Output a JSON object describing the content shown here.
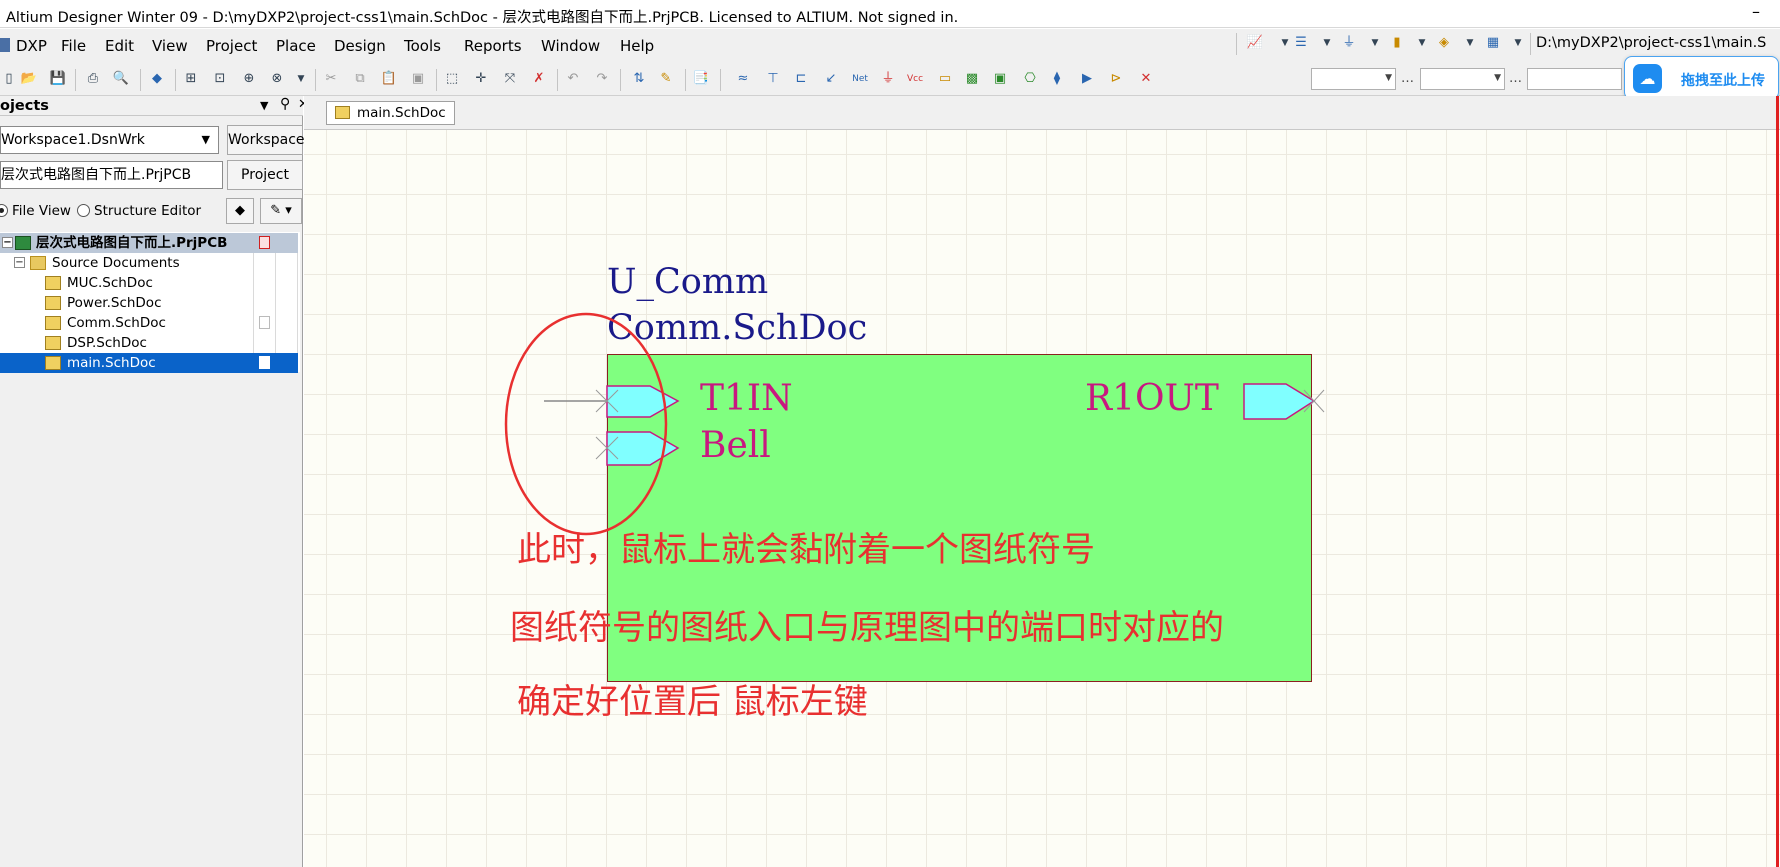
{
  "window": {
    "title": "Altium Designer Winter 09 - D:\\myDXP2\\project-css1\\main.SchDoc - 层次式电路图自下而上.PrjPCB. Licensed to ALTIUM. Not signed in.",
    "minimize_symbol": "–"
  },
  "menu": {
    "items": [
      "DXP",
      "File",
      "Edit",
      "View",
      "Project",
      "Place",
      "Design",
      "Tools",
      "Reports",
      "Window",
      "Help"
    ]
  },
  "path_box": "D:\\myDXP2\\project-css1\\main.S",
  "upload_button": {
    "label": "拖拽至此上传",
    "logo": "baidu-netdisk-icon"
  },
  "projects_panel": {
    "title": "ojects",
    "workspace_field": "Workspace1.DsnWrk",
    "workspace_button": "Workspace",
    "project_field": "层次式电路图自下而上.PrjPCB",
    "project_button": "Project",
    "file_view_label": "File View",
    "structure_editor_label": "Structure Editor",
    "file_view_selected": true,
    "tree": {
      "project": "层次式电路图自下而上.PrjPCB",
      "folder": "Source Documents",
      "documents": [
        "MUC.SchDoc",
        "Power.SchDoc",
        "Comm.SchDoc",
        "DSP.SchDoc",
        "main.SchDoc"
      ],
      "selected_document": "main.SchDoc"
    }
  },
  "document_tab": "main.SchDoc",
  "schematic": {
    "designator": "U_Comm",
    "filename": "Comm.SchDoc",
    "ports": [
      "T1IN",
      "Bell",
      "R1OUT"
    ],
    "sheet_color": "#80ff80",
    "port_color": "#80ffff",
    "port_label_color": "#c81880"
  },
  "annotations": {
    "line1": "此时，鼠标上就会黏附着一个图纸符号",
    "line2": "图纸符号的图纸入口与原理图中的端口时对应的",
    "line3": "确定好位置后 鼠标左键",
    "color": "#e83030"
  }
}
